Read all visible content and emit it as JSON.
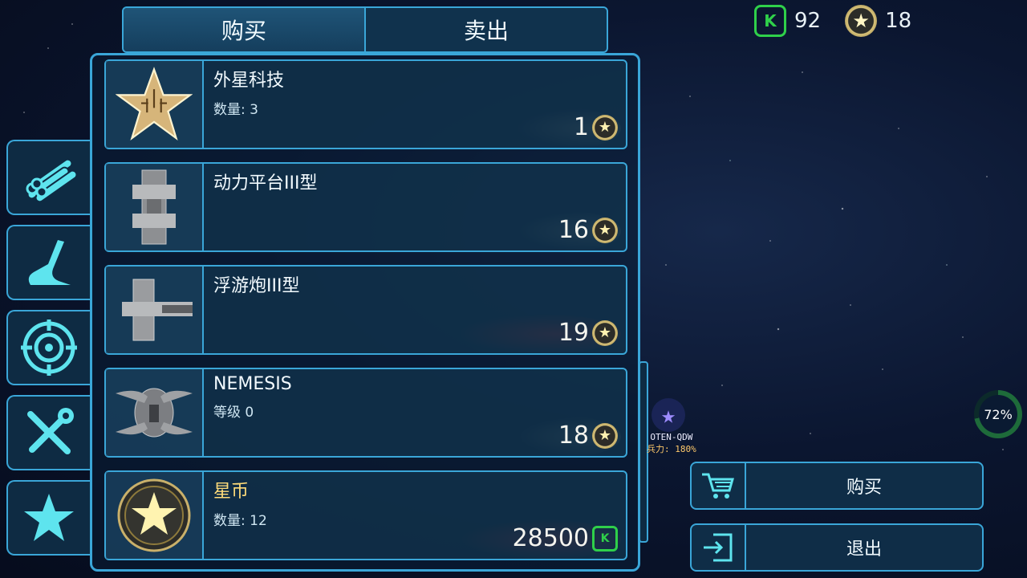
{
  "tabs": {
    "buy": "购买",
    "sell": "卖出"
  },
  "currency": {
    "gems": "92",
    "stars": "18"
  },
  "sidebar": {
    "items": [
      "materials-icon",
      "hull-icon",
      "target-icon",
      "tools-icon",
      "star-icon"
    ]
  },
  "items": [
    {
      "name": "外星科技",
      "sub": "数量: 3",
      "price": "1",
      "currency": "star",
      "highlight": "gold-glow",
      "gold_name": false
    },
    {
      "name": "动力平台III型",
      "sub": "",
      "price": "16",
      "currency": "star",
      "highlight": "gold-glow",
      "gold_name": false
    },
    {
      "name": "浮游炮III型",
      "sub": "",
      "price": "19",
      "currency": "star",
      "highlight": "red-glow",
      "gold_name": false
    },
    {
      "name": "NEMESIS",
      "sub": "等级 0",
      "price": "18",
      "currency": "star",
      "highlight": "gold-glow",
      "gold_name": false
    },
    {
      "name": "星币",
      "sub": "数量: 12",
      "price": "28500",
      "currency": "gem",
      "highlight": "red-glow",
      "gold_name": true
    }
  ],
  "actions": {
    "buy": "购买",
    "exit": "退出"
  },
  "map_marker": {
    "name": "OTEN-QDW",
    "strength": "兵力: 180%"
  },
  "progress": {
    "label": "72%",
    "value": 0.72
  },
  "colors": {
    "accent": "#3aa6d8",
    "gem": "#2fd04a",
    "gold": "#ffdc7a",
    "alert": "#e61e1e"
  }
}
